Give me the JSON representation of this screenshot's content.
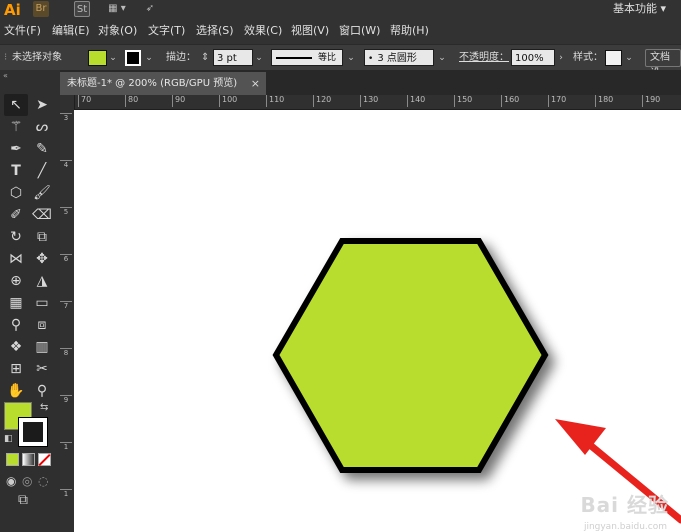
{
  "app": {
    "logo": "Ai",
    "top_icons": [
      "Br",
      "St",
      "▦ ▾",
      "➶"
    ],
    "workspace": "基本功能 ▾"
  },
  "menu": [
    "文件(F)",
    "编辑(E)",
    "对象(O)",
    "文字(T)",
    "选择(S)",
    "效果(C)",
    "视图(V)",
    "窗口(W)",
    "帮助(H)"
  ],
  "control_bar": {
    "selection": "未选择对象",
    "fill_color": "#b9dd2d",
    "stroke_label": "描边：",
    "stroke_value": "3 pt",
    "line_label": "等比",
    "brush_label": "3 点圆形",
    "opacity_label": "不透明度：",
    "opacity_value": "100%",
    "style_label": "样式：",
    "doc_setup": "文档设"
  },
  "tab": {
    "title": "未标题-1* @ 200% (RGB/GPU 预览)",
    "close": "×"
  },
  "ruler": {
    "h_ticks": [
      "70",
      "80",
      "90",
      "100",
      "110",
      "120",
      "130",
      "140",
      "150",
      "160",
      "170",
      "180",
      "190"
    ],
    "v_ticks": [
      "3",
      "4",
      "5",
      "6",
      "7",
      "8",
      "9",
      "1",
      "1"
    ]
  },
  "shape": {
    "type": "hexagon",
    "fill": "#b9dd2d",
    "stroke": "#000000"
  },
  "colors": {
    "fill": "#b9dd2d",
    "stroke": "#000000",
    "arrow": "#e8231e"
  },
  "watermark": {
    "text": "Bai 经验",
    "sub": "jingyan.baidu.com"
  }
}
